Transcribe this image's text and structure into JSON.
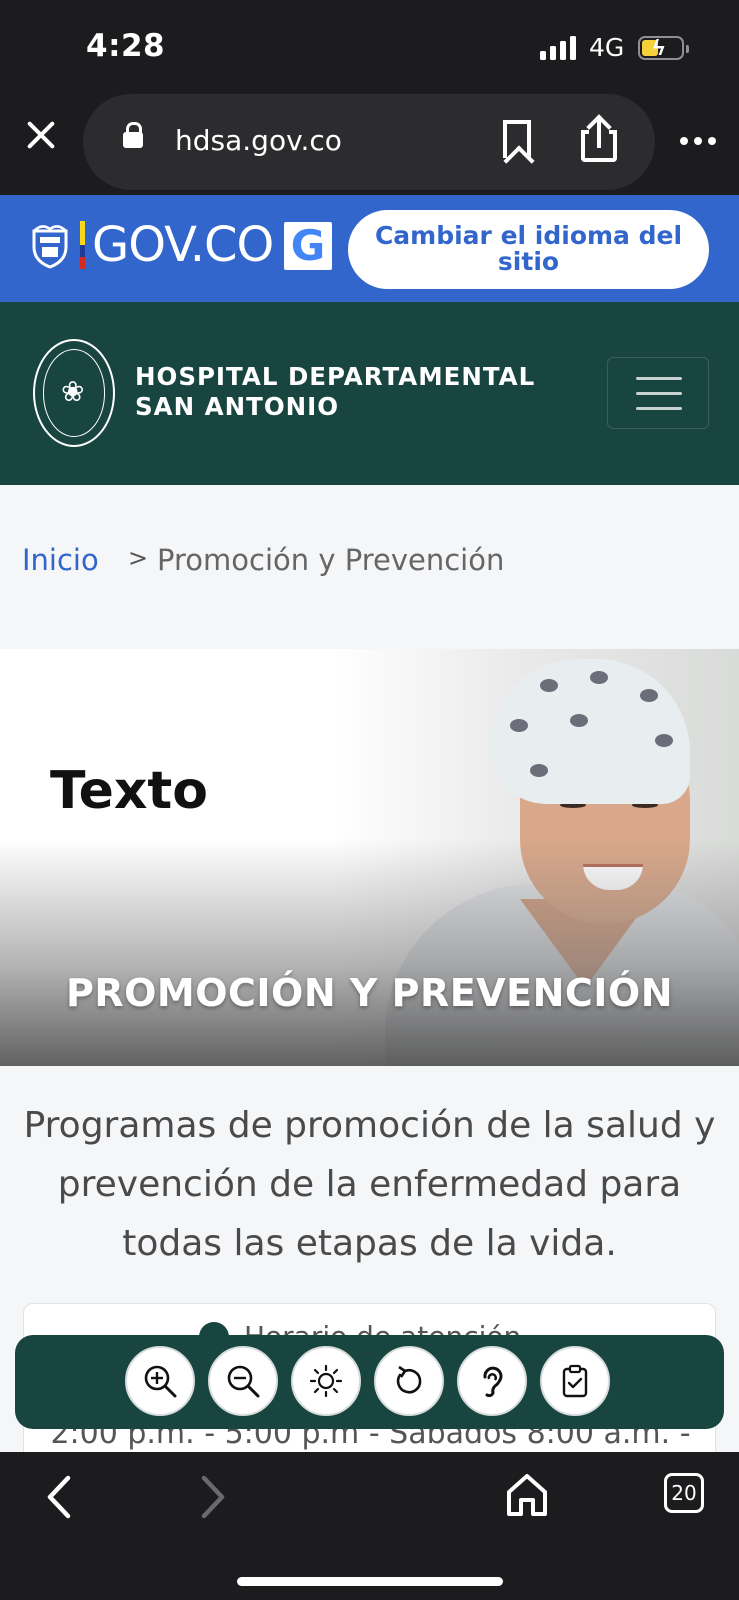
{
  "status_bar": {
    "time": "4:28",
    "network": "4G"
  },
  "browser": {
    "url": "hdsa.gov.co",
    "tab_count": "20"
  },
  "gov_banner": {
    "brand": "GOV.CO",
    "translate_logo": "G",
    "language_button": "Cambiar el idioma del sitio",
    "color": "#3366cc"
  },
  "header": {
    "hospital_name_line1": "HOSPITAL DEPARTAMENTAL",
    "hospital_name_line2": "SAN ANTONIO",
    "color": "#194541"
  },
  "breadcrumb": {
    "home": "Inicio",
    "separator": ">",
    "current": "Promoción y Prevención"
  },
  "hero": {
    "tag": "Texto",
    "title": "PROMOCIÓN Y PREVENCIÓN"
  },
  "main": {
    "intro": "Programas de promoción de la salud y prevención de la enfermedad para todas las etapas de la vida.",
    "hours_title": "Horario de atención",
    "hours_text": "2:00 p.m. - 5:00 p.m - Sábados 8:00 a.m. -"
  },
  "accessibility_toolbar": {
    "buttons": [
      "zoom-in-icon",
      "zoom-out-icon",
      "contrast-icon",
      "reset-icon",
      "hearing-icon",
      "clipboard-check-icon"
    ]
  }
}
